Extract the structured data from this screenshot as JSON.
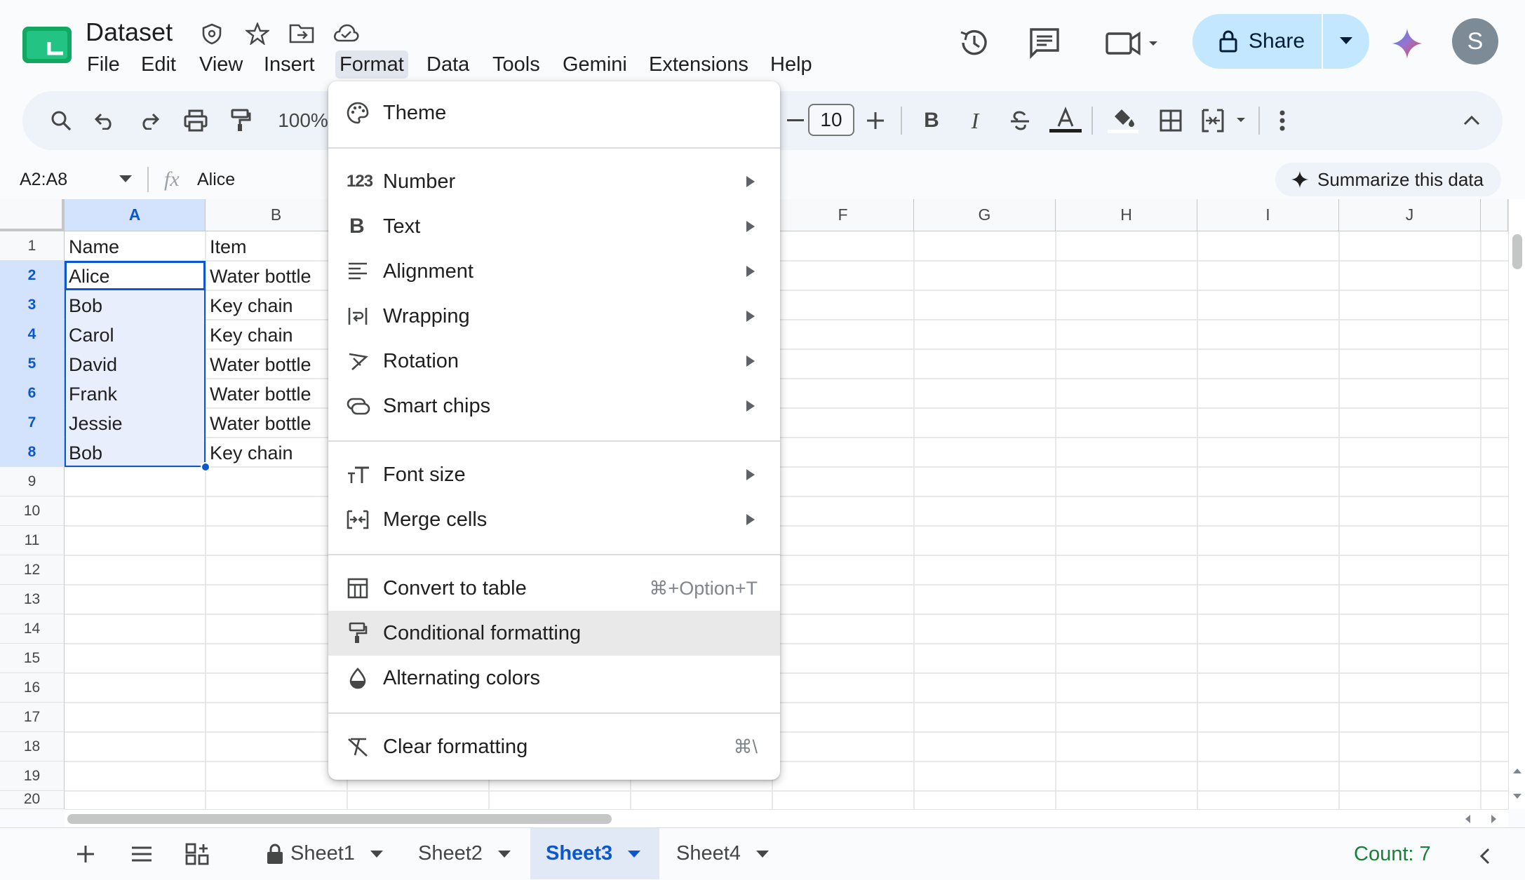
{
  "document": {
    "title": "Dataset"
  },
  "menubar": [
    "File",
    "Edit",
    "View",
    "Insert",
    "Format",
    "Data",
    "Tools",
    "Gemini",
    "Extensions",
    "Help"
  ],
  "header": {
    "share_label": "Share",
    "avatar_letter": "S"
  },
  "toolbar": {
    "zoom": "100%",
    "font_size": "10"
  },
  "formula_bar": {
    "name_box": "A2:A8",
    "fx": "fx",
    "value": "Alice",
    "summarize_label": "Summarize this data"
  },
  "columns": [
    "A",
    "B",
    "F",
    "G",
    "H",
    "I",
    "J"
  ],
  "rows": [
    "1",
    "2",
    "3",
    "4",
    "5",
    "6",
    "7",
    "8",
    "9",
    "10",
    "11",
    "12",
    "13",
    "14",
    "15",
    "16",
    "17",
    "18",
    "19",
    "20"
  ],
  "cells": {
    "headers": [
      "Name",
      "Item"
    ],
    "data": [
      [
        "Alice",
        "Water bottle"
      ],
      [
        "Bob",
        "Key chain"
      ],
      [
        "Carol",
        "Key chain"
      ],
      [
        "David",
        "Water bottle"
      ],
      [
        "Frank",
        "Water bottle"
      ],
      [
        "Jessie",
        "Water bottle"
      ],
      [
        "Bob",
        "Key chain"
      ]
    ]
  },
  "format_menu": {
    "theme": "Theme",
    "number": "Number",
    "text": "Text",
    "alignment": "Alignment",
    "wrapping": "Wrapping",
    "rotation": "Rotation",
    "smart_chips": "Smart chips",
    "font_size": "Font size",
    "merge_cells": "Merge cells",
    "convert_to_table": "Convert to table",
    "convert_to_table_shortcut": "⌘+Option+T",
    "conditional_formatting": "Conditional formatting",
    "alternating_colors": "Alternating colors",
    "clear_formatting": "Clear formatting",
    "clear_formatting_shortcut": "⌘\\"
  },
  "sheets": [
    "Sheet1",
    "Sheet2",
    "Sheet3",
    "Sheet4"
  ],
  "active_sheet": "Sheet3",
  "status": {
    "count": "Count: 7"
  },
  "colors": {
    "accent": "#0b57d0",
    "share_bg": "#c2e7ff",
    "selection": "#e8eefb",
    "sheets_green": "#0f9d58"
  }
}
